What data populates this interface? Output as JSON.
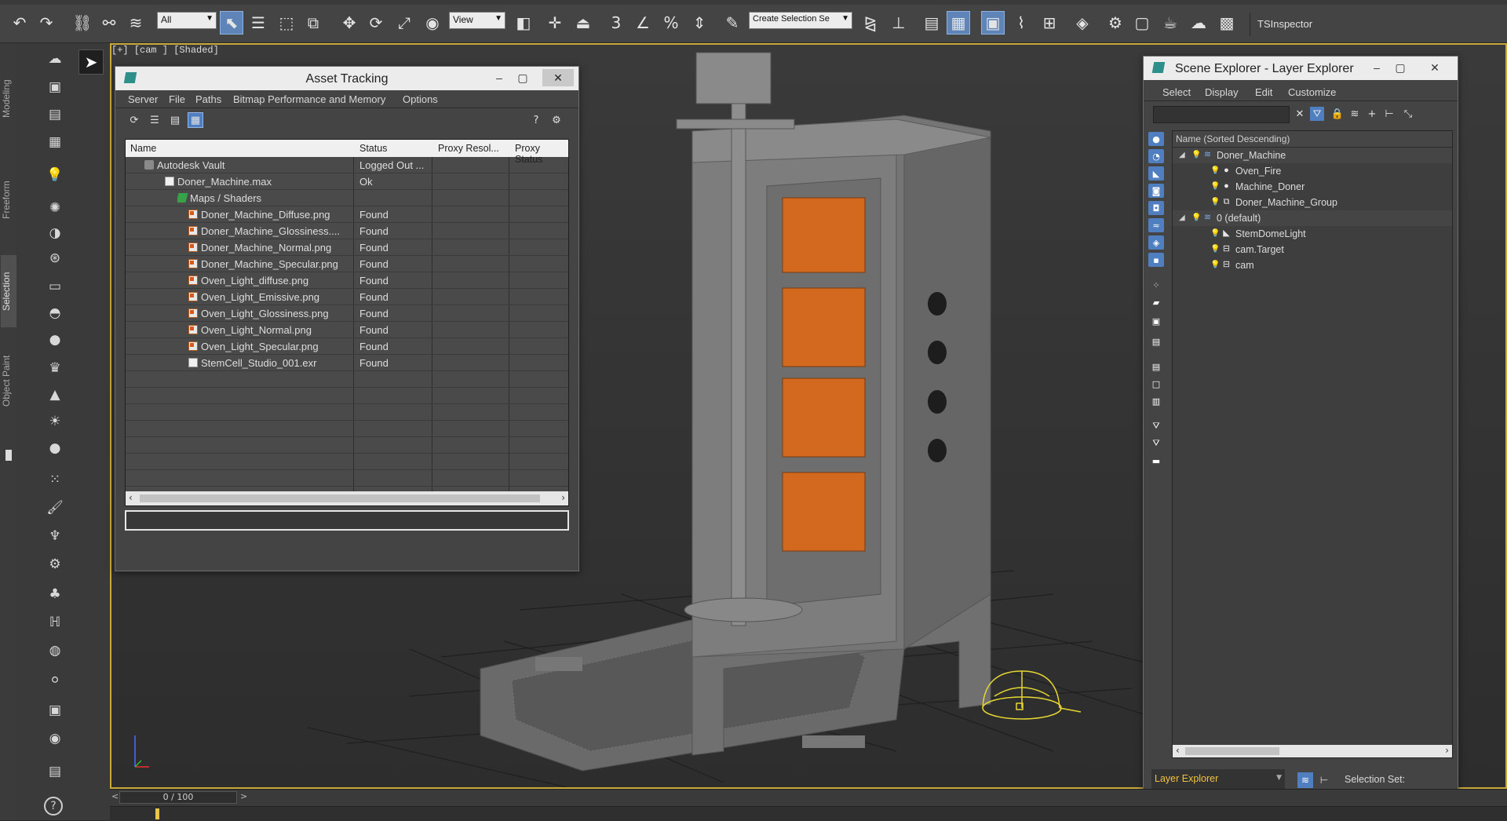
{
  "toolbar": {
    "selection_filter": "All",
    "reference_coord": "View",
    "named_selection_placeholder": "Create Selection Se",
    "tsinspector_label": "TSInspector",
    "snap_label": "3",
    "percent_label": "%"
  },
  "ribbon": {
    "tabs": [
      "Modeling",
      "Freeform",
      "Selection",
      "Object Paint"
    ],
    "selected": "Selection"
  },
  "viewport": {
    "label": "[+] [cam ] [Shaded]"
  },
  "asset_tracking": {
    "title": "Asset Tracking",
    "menu": [
      "Server",
      "File",
      "Paths",
      "Bitmap Performance and Memory",
      "Options"
    ],
    "columns": [
      "Name",
      "Status",
      "Proxy Resol...",
      "Proxy Status"
    ],
    "rows": [
      {
        "name": "Autodesk Vault",
        "status": "Logged Out ...",
        "icon": "vault-icon"
      },
      {
        "name": "Doner_Machine.max",
        "status": "Ok",
        "icon": "max-file-icon"
      },
      {
        "name": "Maps / Shaders",
        "status": "",
        "icon": "maps-icon"
      },
      {
        "name": "Doner_Machine_Diffuse.png",
        "status": "Found",
        "icon": "image-file-icon"
      },
      {
        "name": "Doner_Machine_Glossiness....",
        "status": "Found",
        "icon": "image-file-icon"
      },
      {
        "name": "Doner_Machine_Normal.png",
        "status": "Found",
        "icon": "image-file-icon"
      },
      {
        "name": "Doner_Machine_Specular.png",
        "status": "Found",
        "icon": "image-file-icon"
      },
      {
        "name": "Oven_Light_diffuse.png",
        "status": "Found",
        "icon": "image-file-icon"
      },
      {
        "name": "Oven_Light_Emissive.png",
        "status": "Found",
        "icon": "image-file-icon"
      },
      {
        "name": "Oven_Light_Glossiness.png",
        "status": "Found",
        "icon": "image-file-icon"
      },
      {
        "name": "Oven_Light_Normal.png",
        "status": "Found",
        "icon": "image-file-icon"
      },
      {
        "name": "Oven_Light_Specular.png",
        "status": "Found",
        "icon": "image-file-icon"
      },
      {
        "name": "StemCell_Studio_001.exr",
        "status": "Found",
        "icon": "exr-file-icon"
      }
    ]
  },
  "scene_explorer": {
    "title": "Scene Explorer - Layer Explorer",
    "menu": [
      "Select",
      "Display",
      "Edit",
      "Customize"
    ],
    "column_header": "Name (Sorted Descending)",
    "tree": [
      {
        "label": "Doner_Machine",
        "type": "layer",
        "expanded": true
      },
      {
        "label": "Oven_Fire",
        "type": "geometry"
      },
      {
        "label": "Machine_Doner",
        "type": "geometry"
      },
      {
        "label": "Doner_Machine_Group",
        "type": "group"
      },
      {
        "label": "0 (default)",
        "type": "layer",
        "expanded": true
      },
      {
        "label": "StemDomeLight",
        "type": "light"
      },
      {
        "label": "cam.Target",
        "type": "camera"
      },
      {
        "label": "cam",
        "type": "camera"
      }
    ],
    "footer_dropdown": "Layer Explorer",
    "footer_selection_label": "Selection Set:"
  },
  "timeline": {
    "frame_readout": "0 / 100"
  },
  "colors": {
    "viewport_border": "#c8a93a",
    "active_button": "#5e84b8",
    "heater_orange": "#d2691e",
    "camera_gizmo": "#e5d632"
  }
}
